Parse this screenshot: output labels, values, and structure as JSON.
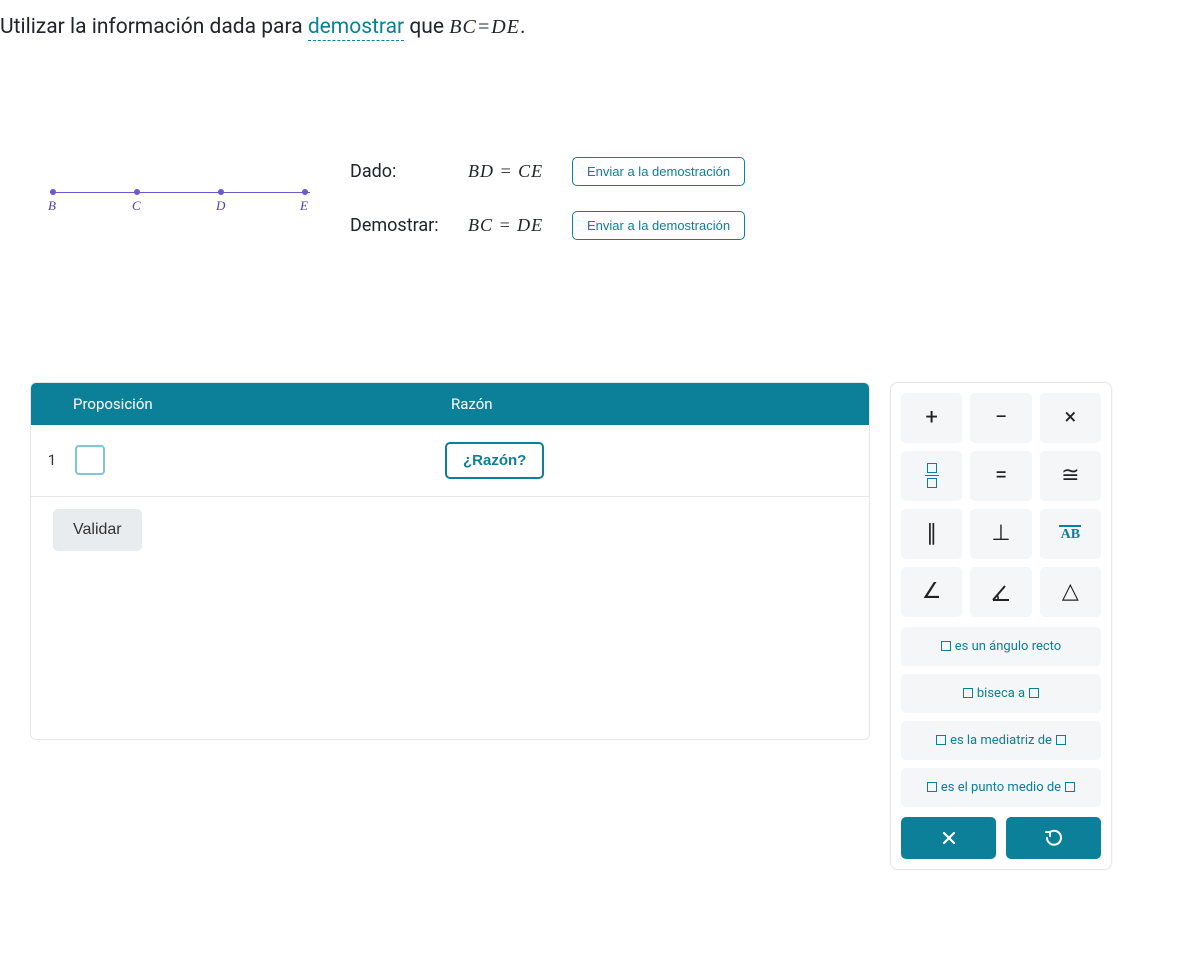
{
  "prompt": {
    "pre": "Utilizar la información dada para ",
    "link": "demostrar",
    "post1": " que ",
    "math": "BC=DE",
    "post2": "."
  },
  "diagram": {
    "points": [
      "B",
      "C",
      "D",
      "E"
    ]
  },
  "givens": {
    "given_label": "Dado:",
    "given_expr": "BD = CE",
    "prove_label": "Demostrar:",
    "prove_expr": "BC = DE",
    "send_label": "Enviar a la demostración"
  },
  "proof": {
    "header_prop": "Proposición",
    "header_reason": "Razón",
    "rows": [
      {
        "num": "1",
        "reason_label": "¿Razón?"
      }
    ],
    "validate_label": "Validar"
  },
  "keypad": {
    "symbols": {
      "plus": "+",
      "minus": "−",
      "times": "×",
      "equals": "=",
      "congruent": "≅",
      "parallel": "∥",
      "perp": "⊥",
      "angle": "∠",
      "triangle": "△"
    },
    "segment_label": "AB",
    "phrases": {
      "right_angle": "es un ángulo recto",
      "bisects": "biseca a",
      "perp_bisector": "es la mediatriz de",
      "midpoint": "es el punto medio de"
    }
  }
}
